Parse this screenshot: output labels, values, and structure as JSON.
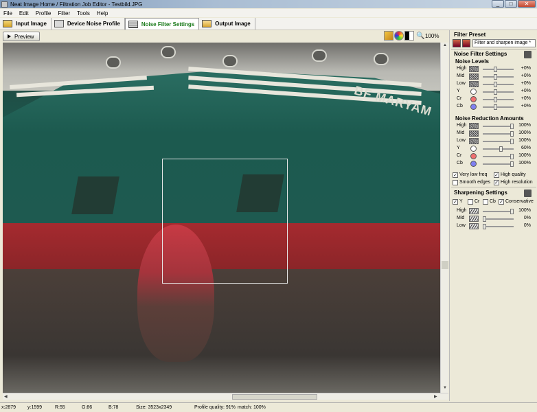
{
  "window": {
    "title": "Neat Image Home / Filtration Job Editor - Testbild.JPG"
  },
  "menu": [
    "File",
    "Edit",
    "Profile",
    "Filter",
    "Tools",
    "Help"
  ],
  "tabs": [
    {
      "label": "Input Image",
      "icon": "home-icon"
    },
    {
      "label": "Device Noise Profile",
      "icon": "device-icon"
    },
    {
      "label": "Noise Filter Settings",
      "icon": "filter-icon",
      "active": true
    },
    {
      "label": "Output Image",
      "icon": "output-icon"
    }
  ],
  "toolbar": {
    "preview_label": "Preview",
    "zoom": "100%"
  },
  "image": {
    "ship_name": "BF MARYAM"
  },
  "panel": {
    "preset_title": "Filter Preset",
    "preset_value": "Filter and sharpen image *",
    "nfs_title": "Noise Filter Settings",
    "noise_levels_title": "Noise Levels",
    "noise_levels": [
      {
        "label": "High",
        "value": "+0%",
        "level": 0.4
      },
      {
        "label": "Mid",
        "value": "+0%",
        "level": 0.4
      },
      {
        "label": "Low",
        "value": "+0%",
        "level": 0.4
      },
      {
        "label": "Y",
        "value": "+0%",
        "level": 0.4,
        "color": "#ffffff"
      },
      {
        "label": "Cr",
        "value": "+0%",
        "level": 0.4,
        "color": "#f07070"
      },
      {
        "label": "Cb",
        "value": "+0%",
        "level": 0.4,
        "color": "#8080f0"
      }
    ],
    "reduction_title": "Noise Reduction Amounts",
    "reduction": [
      {
        "label": "High",
        "value": "100%",
        "level": 1.0
      },
      {
        "label": "Mid",
        "value": "100%",
        "level": 1.0
      },
      {
        "label": "Low",
        "value": "100%",
        "level": 1.0
      },
      {
        "label": "Y",
        "value": "60%",
        "level": 0.6,
        "color": "#ffffff"
      },
      {
        "label": "Cr",
        "value": "100%",
        "level": 1.0,
        "color": "#f07070"
      },
      {
        "label": "Cb",
        "value": "100%",
        "level": 1.0,
        "color": "#8080f0"
      }
    ],
    "options": [
      {
        "label": "Very low freq",
        "checked": true
      },
      {
        "label": "High quality",
        "checked": true
      },
      {
        "label": "Smooth edges",
        "checked": false
      },
      {
        "label": "High resolution",
        "checked": true
      }
    ],
    "sharp_title": "Sharpening Settings",
    "sharp_channels": [
      {
        "label": "Y",
        "checked": true
      },
      {
        "label": "Cr",
        "checked": false
      },
      {
        "label": "Cb",
        "checked": false
      },
      {
        "label": "Conservative",
        "checked": true
      }
    ],
    "sharp": [
      {
        "label": "High",
        "value": "100%",
        "level": 1.0
      },
      {
        "label": "Mid",
        "value": "0%",
        "level": 0.0
      },
      {
        "label": "Low",
        "value": "0%",
        "level": 0.0
      }
    ]
  },
  "status": {
    "x": "x:2879",
    "y": "y:1599",
    "r": "R:55",
    "g": "G:86",
    "b": "B:78",
    "size": "Size: 3523x2349",
    "quality": "Profile quality: 91%",
    "match": "match: 100%"
  }
}
